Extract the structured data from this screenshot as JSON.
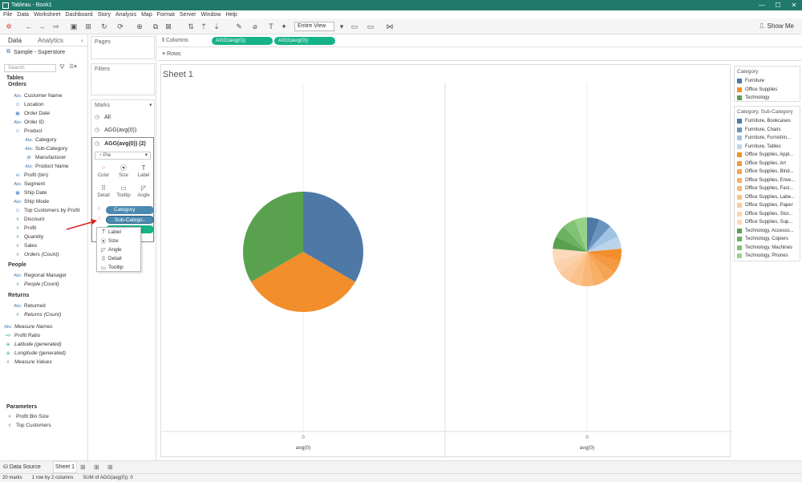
{
  "titlebar": {
    "title": "Tableau - Book1",
    "controls": [
      "—",
      "☐",
      "✕"
    ]
  },
  "menu": [
    "File",
    "Data",
    "Worksheet",
    "Dashboard",
    "Story",
    "Analysis",
    "Map",
    "Format",
    "Server",
    "Window",
    "Help"
  ],
  "toolbar": {
    "view_select": "Entire View",
    "show_me": "Show Me"
  },
  "data_pane": {
    "tabs": [
      "Data",
      "Analytics"
    ],
    "datasource": "Sample - Superstore",
    "search_placeholder": "Search",
    "tables_label": "Tables",
    "orders": {
      "label": "Orders",
      "fields": [
        {
          "icon": "Abc",
          "name": "Customer Name",
          "kind": "dim"
        },
        {
          "icon": "⚇",
          "name": "Location",
          "kind": "dim"
        },
        {
          "icon": "▦",
          "name": "Order Date",
          "kind": "dim"
        },
        {
          "icon": "Abc",
          "name": "Order ID",
          "kind": "dim"
        },
        {
          "icon": "⚇",
          "name": "Product",
          "kind": "dim"
        },
        {
          "icon": "Abc",
          "name": "Category",
          "kind": "dim",
          "indent": 1
        },
        {
          "icon": "Abc",
          "name": "Sub-Category",
          "kind": "dim",
          "indent": 1
        },
        {
          "icon": "Ø",
          "name": "Manufacturer",
          "kind": "dim",
          "indent": 1
        },
        {
          "icon": "Abc",
          "name": "Product Name",
          "kind": "dim",
          "indent": 1
        },
        {
          "icon": "ılı",
          "name": "Profit (bin)",
          "kind": "dim"
        },
        {
          "icon": "Abc",
          "name": "Segment",
          "kind": "dim"
        },
        {
          "icon": "▦",
          "name": "Ship Date",
          "kind": "dim"
        },
        {
          "icon": "Abc",
          "name": "Ship Mode",
          "kind": "dim"
        },
        {
          "icon": "⚇",
          "name": "Top Customers by Profit",
          "kind": "dim"
        },
        {
          "icon": "#",
          "name": "Discount",
          "kind": "mea"
        },
        {
          "icon": "#",
          "name": "Profit",
          "kind": "mea"
        },
        {
          "icon": "#",
          "name": "Quantity",
          "kind": "mea"
        },
        {
          "icon": "#",
          "name": "Sales",
          "kind": "mea"
        },
        {
          "icon": "#",
          "name": "Orders (Count)",
          "kind": "mea"
        }
      ]
    },
    "people": {
      "label": "People",
      "fields": [
        {
          "icon": "Abc",
          "name": "Regional Manager",
          "kind": "dim"
        },
        {
          "icon": "#",
          "name": "People (Count)",
          "kind": "mea"
        }
      ]
    },
    "returns": {
      "label": "Returns",
      "fields": [
        {
          "icon": "Abc",
          "name": "Returned",
          "kind": "dim"
        },
        {
          "icon": "#",
          "name": "Returns (Count)",
          "kind": "mea"
        }
      ]
    },
    "extra_fields": [
      {
        "icon": "Abc",
        "name": "Measure Names",
        "kind": "dim"
      },
      {
        "icon": "=#",
        "name": "Profit Ratio",
        "kind": "mea"
      },
      {
        "icon": "⊕",
        "name": "Latitude (generated)",
        "kind": "mea"
      },
      {
        "icon": "⊕",
        "name": "Longitude (generated)",
        "kind": "mea"
      },
      {
        "icon": "#",
        "name": "Measure Values",
        "kind": "mea"
      }
    ],
    "parameters_label": "Parameters",
    "parameters": [
      {
        "icon": "#",
        "name": "Profit Bin Size"
      },
      {
        "icon": "#",
        "name": "Top Customers"
      }
    ]
  },
  "shelves": {
    "pages_label": "Pages",
    "filters_label": "Filters",
    "marks_label": "Marks",
    "marks_all": "All",
    "marks_agg1": "AGG(avg(0))",
    "marks_agg2": "AGG(avg(0)) (2)",
    "mark_type": "Pie",
    "mark_buttons": [
      "Color",
      "Size",
      "Label",
      "Detail",
      "Tooltip",
      "Angle"
    ],
    "category_pill": "Category",
    "subcategory_pill": "Sub-Catego.."
  },
  "context_menu": [
    "Label",
    "Size",
    "Angle",
    "Detail",
    "Tooltip"
  ],
  "columns_shelf": {
    "label": "Columns",
    "pills": [
      "AGG(avg(0))",
      "AGG(avg(0))"
    ]
  },
  "rows_shelf": {
    "label": "Rows"
  },
  "sheet_title": "Sheet 1",
  "axis": {
    "tick": "0",
    "label": "avg(0)"
  },
  "legend_category": {
    "title": "Category",
    "items": [
      {
        "label": "Furniture",
        "color": "#4e79a7"
      },
      {
        "label": "Office Supplies",
        "color": "#f28e2b"
      },
      {
        "label": "Technology",
        "color": "#59a14f"
      }
    ]
  },
  "legend_subcategory": {
    "title": "Category, Sub-Category",
    "items": [
      {
        "label": "Furniture, Bookcases",
        "color": "#4e79a7"
      },
      {
        "label": "Furniture, Chairs",
        "color": "#6b93c0"
      },
      {
        "label": "Furniture, Furnishin...",
        "color": "#a0c4e4"
      },
      {
        "label": "Furniture, Tables",
        "color": "#bcd4ea"
      },
      {
        "label": "Office Supplies, Appl...",
        "color": "#f28e2b"
      },
      {
        "label": "Office Supplies, Art",
        "color": "#f4993f"
      },
      {
        "label": "Office Supplies, Bind...",
        "color": "#f6a452"
      },
      {
        "label": "Office Supplies, Enve...",
        "color": "#f8af66"
      },
      {
        "label": "Office Supplies, Fast...",
        "color": "#f9b878"
      },
      {
        "label": "Office Supplies, Labe...",
        "color": "#fac18a"
      },
      {
        "label": "Office Supplies, Paper",
        "color": "#fbc99b"
      },
      {
        "label": "Office Supplies, Stor...",
        "color": "#fcd2ad"
      },
      {
        "label": "Office Supplies, Sup...",
        "color": "#fdd9bb"
      },
      {
        "label": "Technology, Accesso...",
        "color": "#59a14f"
      },
      {
        "label": "Technology, Copiers",
        "color": "#6db262"
      },
      {
        "label": "Technology, Machines",
        "color": "#82c275"
      },
      {
        "label": "Technology, Phones",
        "color": "#98d28a"
      }
    ]
  },
  "chart_data": [
    {
      "type": "pie",
      "categories": [
        "Furniture",
        "Office Supplies",
        "Technology"
      ],
      "values": [
        1,
        1,
        1
      ],
      "colors": [
        "#4e79a7",
        "#f28e2b",
        "#59a14f"
      ],
      "xlabel": "avg(0)"
    },
    {
      "type": "pie",
      "categories": [
        "Furniture, Bookcases",
        "Furniture, Chairs",
        "Furniture, Furnishings",
        "Furniture, Tables",
        "Office Supplies, Appliances",
        "Office Supplies, Art",
        "Office Supplies, Binders",
        "Office Supplies, Envelopes",
        "Office Supplies, Fasteners",
        "Office Supplies, Labels",
        "Office Supplies, Paper",
        "Office Supplies, Storage",
        "Office Supplies, Supplies",
        "Technology, Accessories",
        "Technology, Copiers",
        "Technology, Machines",
        "Technology, Phones"
      ],
      "values": [
        1,
        1,
        1,
        1,
        1,
        1,
        1,
        1,
        1,
        1,
        1,
        1,
        1,
        1,
        1,
        1,
        1
      ],
      "colors": [
        "#4e79a7",
        "#6b93c0",
        "#a0c4e4",
        "#bcd4ea",
        "#f28e2b",
        "#f4993f",
        "#f6a452",
        "#f8af66",
        "#f9b878",
        "#fac18a",
        "#fbc99b",
        "#fcd2ad",
        "#fdd9bb",
        "#59a14f",
        "#6db262",
        "#82c275",
        "#98d28a"
      ],
      "xlabel": "avg(0)"
    }
  ],
  "tabs": {
    "data_source": "Data Source",
    "sheet": "Sheet 1"
  },
  "status": [
    "20 marks",
    "1 row by 2 columns",
    "SUM of AGG(avg(0)): 0"
  ]
}
